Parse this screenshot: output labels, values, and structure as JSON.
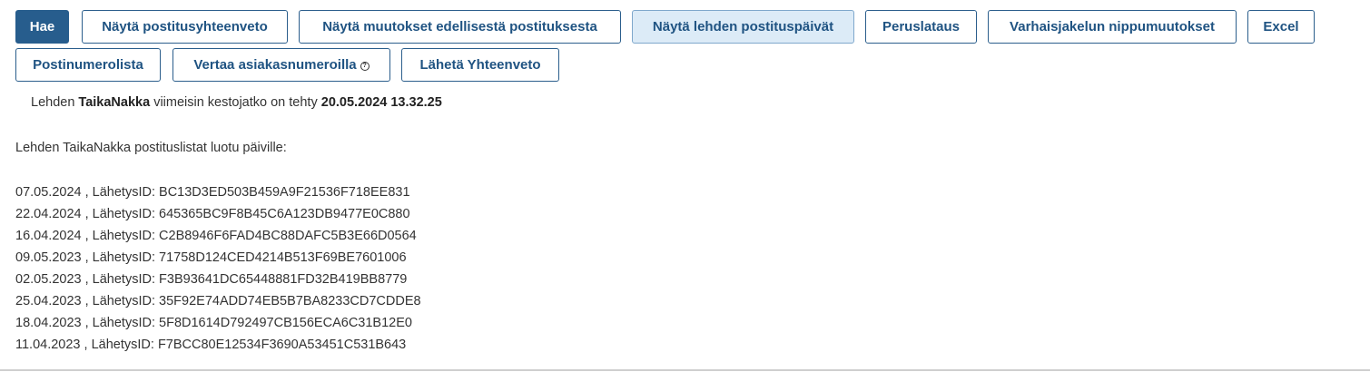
{
  "toolbar": {
    "row1": [
      {
        "name": "search-button",
        "label": "Hae",
        "style": "primary"
      },
      {
        "name": "show-posting-summary-button",
        "label": "Näytä postitusyhteenveto",
        "style": "default"
      },
      {
        "name": "show-changes-since-last-posting-button",
        "label": "Näytä muutokset edellisestä postituksesta",
        "style": "default"
      },
      {
        "name": "show-magazine-posting-dates-button",
        "label": "Näytä lehden postituspäivät",
        "style": "active"
      },
      {
        "name": "basic-load-button",
        "label": "Peruslataus",
        "style": "default"
      },
      {
        "name": "early-delivery-bundle-changes-button",
        "label": "Varhaisjakelun nippumuutokset",
        "style": "default"
      },
      {
        "name": "excel-button",
        "label": "Excel",
        "style": "default"
      }
    ],
    "row2": [
      {
        "name": "postal-code-list-button",
        "label": "Postinumerolista",
        "style": "default"
      },
      {
        "name": "compare-customer-numbers-button",
        "label": "Vertaa asiakasnumeroilla",
        "style": "default",
        "icon": "help-icon"
      },
      {
        "name": "send-summary-button",
        "label": "Lähetä Yhteenveto",
        "style": "default"
      }
    ]
  },
  "info": {
    "prefix": "Lehden",
    "magazine": "TaikaNakka",
    "middle": "viimeisin kestojatko on tehty",
    "timestamp": "20.05.2024 13.32.25"
  },
  "list_title": "Lehden TaikaNakka postituslistat luotu päiville:",
  "entries": [
    {
      "date": "07.05.2024",
      "label": "LähetysID:",
      "id": "BC13D3ED503B459A9F21536F718EE831"
    },
    {
      "date": "22.04.2024",
      "label": "LähetysID:",
      "id": "645365BC9F8B45C6A123DB9477E0C880"
    },
    {
      "date": "16.04.2024",
      "label": "LähetysID:",
      "id": "C2B8946F6FAD4BC88DAFC5B3E66D0564"
    },
    {
      "date": "09.05.2023",
      "label": "LähetysID:",
      "id": "71758D124CED4214B513F69BE7601006"
    },
    {
      "date": "02.05.2023",
      "label": "LähetysID:",
      "id": "F3B93641DC65448881FD32B419BB8779"
    },
    {
      "date": "25.04.2023",
      "label": "LähetysID:",
      "id": "35F92E74ADD74EB5B7BA8233CD7CDDE8"
    },
    {
      "date": "18.04.2023",
      "label": "LähetysID:",
      "id": "5F8D1614D792497CB156ECA6C31B12E0"
    },
    {
      "date": "11.04.2023",
      "label": "LähetysID:",
      "id": "F7BCC80E12534F3690A53451C531B643"
    }
  ],
  "colors": {
    "primary": "#275d8d",
    "button_text": "#1f5382",
    "active_bg": "#dcebf7"
  }
}
